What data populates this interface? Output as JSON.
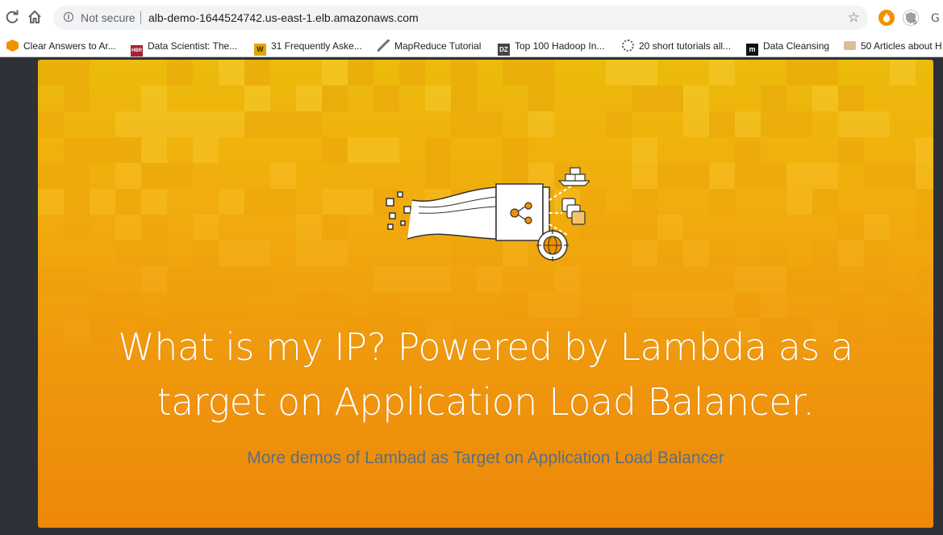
{
  "browser": {
    "not_secure_label": "Not secure",
    "url": "alb-demo-1644524742.us-east-1.elb.amazonaws.com",
    "icons": {
      "reload": "reload-icon",
      "home": "home-icon",
      "info": "info-icon",
      "bookmark_star": "star-icon"
    }
  },
  "bookmarks": [
    {
      "label": "Clear Answers to Ar...",
      "icon": "aws-cube-icon",
      "icon_text": "",
      "color": "#f29100"
    },
    {
      "label": "Data Scientist: The...",
      "icon": "hbr-icon",
      "icon_text": "HBR",
      "color": "#a32035"
    },
    {
      "label": "31 Frequently Aske...",
      "icon": "w-icon",
      "icon_text": "W",
      "color": "#e0a800"
    },
    {
      "label": "MapReduce Tutorial",
      "icon": "tutorial-icon",
      "icon_text": "",
      "color": "#6b7a88"
    },
    {
      "label": "Top 100 Hadoop In...",
      "icon": "dzone-icon",
      "icon_text": "DZ",
      "color": "#444444"
    },
    {
      "label": "20 short tutorials all...",
      "icon": "gear-icon",
      "icon_text": "",
      "color": "#555555"
    },
    {
      "label": "Data Cleansing",
      "icon": "medium-icon",
      "icon_text": "m",
      "color": "#111111"
    },
    {
      "label": "50 Articles about H",
      "icon": "folder-icon",
      "icon_text": "",
      "color": "#c9a36b"
    }
  ],
  "hero": {
    "title": "What is my IP? Powered by Lambda as a target on Application Load Balancer.",
    "link_text": "More demos of Lambad as Target on Application Load Balancer",
    "colors": {
      "gradient_top": "#ecbb0b",
      "gradient_bottom": "#ed880a",
      "link": "#5b6f82"
    },
    "illustration": "load-balancer-illustration"
  }
}
